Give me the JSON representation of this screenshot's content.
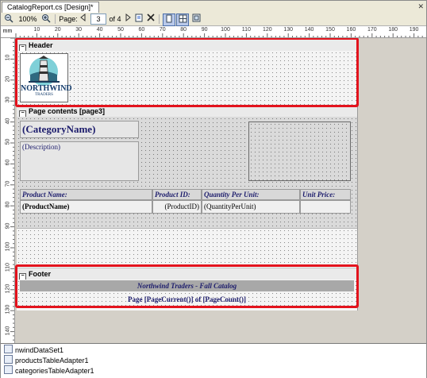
{
  "window": {
    "tab_title": "CatalogReport.cs [Design]*",
    "close_glyph": "✕"
  },
  "toolbar": {
    "zoom": "100%",
    "page_label": "Page:",
    "current_page": "3",
    "page_count_text": "of 4"
  },
  "ruler": {
    "unit": "mm",
    "top_labels": [
      "10",
      "20",
      "30",
      "40",
      "50",
      "60",
      "70",
      "80",
      "90",
      "100",
      "110",
      "120",
      "130",
      "140",
      "150",
      "160",
      "170",
      "180",
      "190"
    ],
    "left_labels": [
      "10",
      "20",
      "30",
      "40",
      "50",
      "60",
      "70",
      "80",
      "90",
      "100",
      "110",
      "120",
      "130",
      "140"
    ]
  },
  "header_band": {
    "title": "Header",
    "logo_main": "NORTHWIND",
    "logo_sub": "TRADERS"
  },
  "contents_band": {
    "title": "Page contents [page3]",
    "category_name": "(CategoryName)",
    "description": "(Description)",
    "columns": [
      "Product Name:",
      "Product ID:",
      "Quantity Per Unit:",
      "Unit Price:"
    ],
    "row": [
      "(ProductName)",
      "(ProductID)",
      "(QuantityPerUnit)",
      ""
    ]
  },
  "footer_band": {
    "title": "Footer",
    "catalog_title": "Northwind Traders - Fall Catalog",
    "page_text": "Page [PageCurrent()] of [PageCount()]"
  },
  "components": [
    {
      "name": "nwindDataSet1"
    },
    {
      "name": "productsTableAdapter1"
    },
    {
      "name": "categoriesTableAdapter1"
    }
  ],
  "colors": {
    "highlight": "#e3131d",
    "title_text": "#1c1c6c",
    "footer_strip": "#a8a8a8"
  }
}
